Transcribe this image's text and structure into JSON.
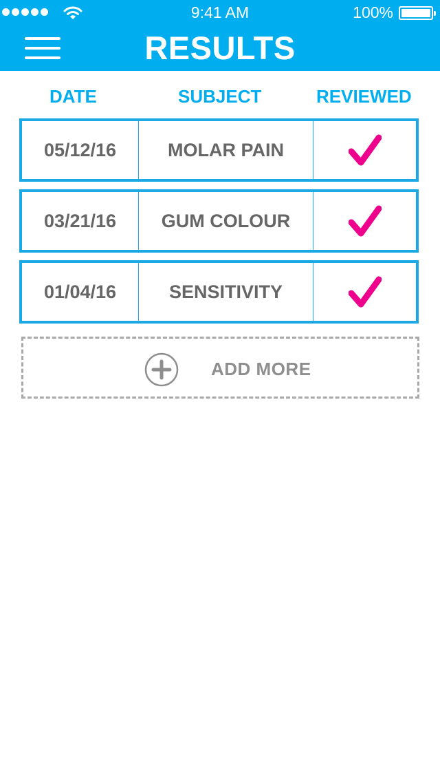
{
  "status_bar": {
    "time": "9:41 AM",
    "battery_percent": "100%",
    "signal_icon": "signal-dots-icon",
    "wifi_icon": "wifi-icon",
    "battery_icon": "battery-icon"
  },
  "header": {
    "title": "RESULTS",
    "menu_icon": "hamburger-menu-icon",
    "background_color": "#00aeef"
  },
  "table": {
    "columns": [
      "DATE",
      "SUBJECT",
      "REVIEWED"
    ],
    "rows": [
      {
        "date": "05/12/16",
        "subject": "MOLAR PAIN",
        "reviewed": true
      },
      {
        "date": "03/21/16",
        "subject": "GUM COLOUR",
        "reviewed": true
      },
      {
        "date": "01/04/16",
        "subject": "SENSITIVITY",
        "reviewed": true
      }
    ],
    "accent_color": "#00aeef",
    "check_color": "#ec008c",
    "check_icon": "checkmark-icon"
  },
  "add_more": {
    "label": "ADD MORE",
    "icon": "plus-circle-icon"
  }
}
